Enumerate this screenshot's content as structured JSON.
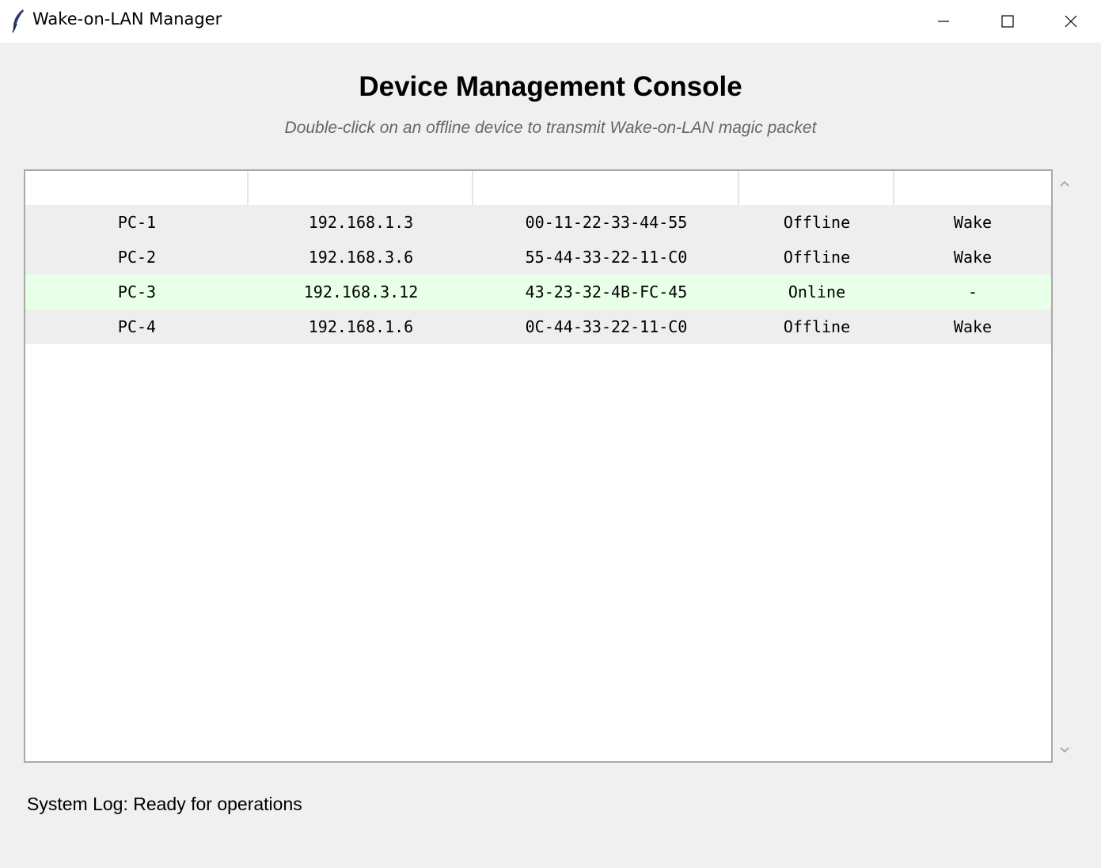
{
  "window": {
    "title": "Wake-on-LAN Manager",
    "controls": [
      "minimize-icon",
      "maximize-icon",
      "close-icon"
    ]
  },
  "main": {
    "heading": "Device Management Console",
    "subheading": "Double-click on an offline device to transmit Wake-on-LAN magic packet"
  },
  "table": {
    "columns": [
      "",
      "",
      "",
      "",
      ""
    ],
    "rows": [
      {
        "name": "PC-1",
        "ip": "192.168.1.3",
        "mac": "00-11-22-33-44-55",
        "status": "Offline",
        "action": "Wake"
      },
      {
        "name": "PC-2",
        "ip": "192.168.3.6",
        "mac": "55-44-33-22-11-C0",
        "status": "Offline",
        "action": "Wake"
      },
      {
        "name": "PC-3",
        "ip": "192.168.3.12",
        "mac": "43-23-32-4B-FC-45",
        "status": "Online",
        "action": "-"
      },
      {
        "name": "PC-4",
        "ip": "192.168.1.6",
        "mac": "0C-44-33-22-11-C0",
        "status": "Offline",
        "action": "Wake"
      }
    ]
  },
  "colors": {
    "offline_row": "#eeeeee",
    "online_row": "#e8ffe8"
  },
  "status_bar": {
    "text": "System Log: Ready for operations"
  }
}
